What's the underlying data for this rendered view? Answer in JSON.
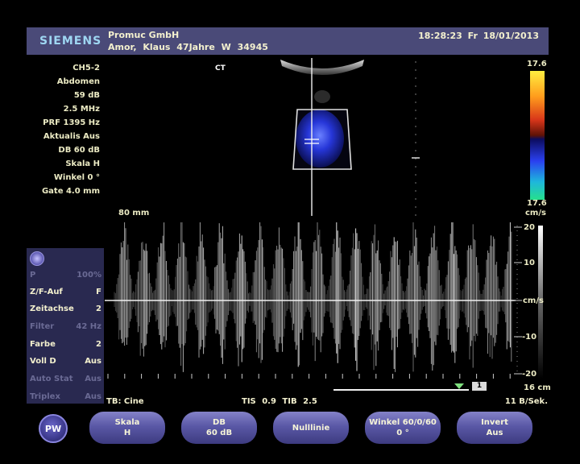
{
  "header": {
    "brand": "SIEMENS",
    "organization": "Promuc GmbH",
    "patient": "Amor, Klaus   47Jahre   W   34945",
    "datetime": "18:28:23  Fr  18/01/2013"
  },
  "params": [
    "CH5-2",
    "Abdomen",
    "59 dB",
    "2.5 MHz",
    "PRF 1395 Hz",
    "Aktualis Aus",
    "DB 60 dB",
    "Skala H",
    "Winkel 0 °",
    "Gate 4.0 mm"
  ],
  "depth_label": "80 mm",
  "bmode": {
    "marker": "CT"
  },
  "colorbar": {
    "top": "17.6",
    "bottom": "17.6",
    "unit": "cm/s"
  },
  "left_panel": {
    "icon": "doppler-mode-icon",
    "rows": [
      {
        "label": "P",
        "value": "100%",
        "active": false
      },
      {
        "label": "Z/F-Auf",
        "value": "F",
        "active": true
      },
      {
        "label": "Zeitachse",
        "value": "2",
        "active": true
      },
      {
        "label": "Filter",
        "value": "42 Hz",
        "active": false
      },
      {
        "label": "Farbe",
        "value": "2",
        "active": true
      },
      {
        "label": "Voll D",
        "value": "Aus",
        "active": true
      },
      {
        "label": "Auto Stat",
        "value": "Aus",
        "active": false
      },
      {
        "label": "Triplex",
        "value": "Aus",
        "active": false
      }
    ]
  },
  "spectrum_scale": {
    "top": "20",
    "upper": "10",
    "unit": "cm/s",
    "lower": "-10",
    "bottom": "-20"
  },
  "footer": {
    "left": "TB: Cine",
    "center": "TIS 0.9   TIB 2.5",
    "right": "11 B/Sek.",
    "depth": "16 cm",
    "cine_frame": "1"
  },
  "softkeys": {
    "mode": "PW",
    "buttons": [
      {
        "line1": "Skala",
        "line2": "H"
      },
      {
        "line1": "DB",
        "line2": "60 dB"
      },
      {
        "line1": "Nulllinie",
        "line2": ""
      },
      {
        "line1": "Winkel 60/0/60",
        "line2": "0 °"
      },
      {
        "line1": "Invert",
        "line2": "Aus"
      }
    ]
  },
  "colors": {
    "header_bg": "#4a4a78",
    "panel_bg": "#292950",
    "text": "#f3f0ce",
    "accent": "#9ed6f2"
  }
}
